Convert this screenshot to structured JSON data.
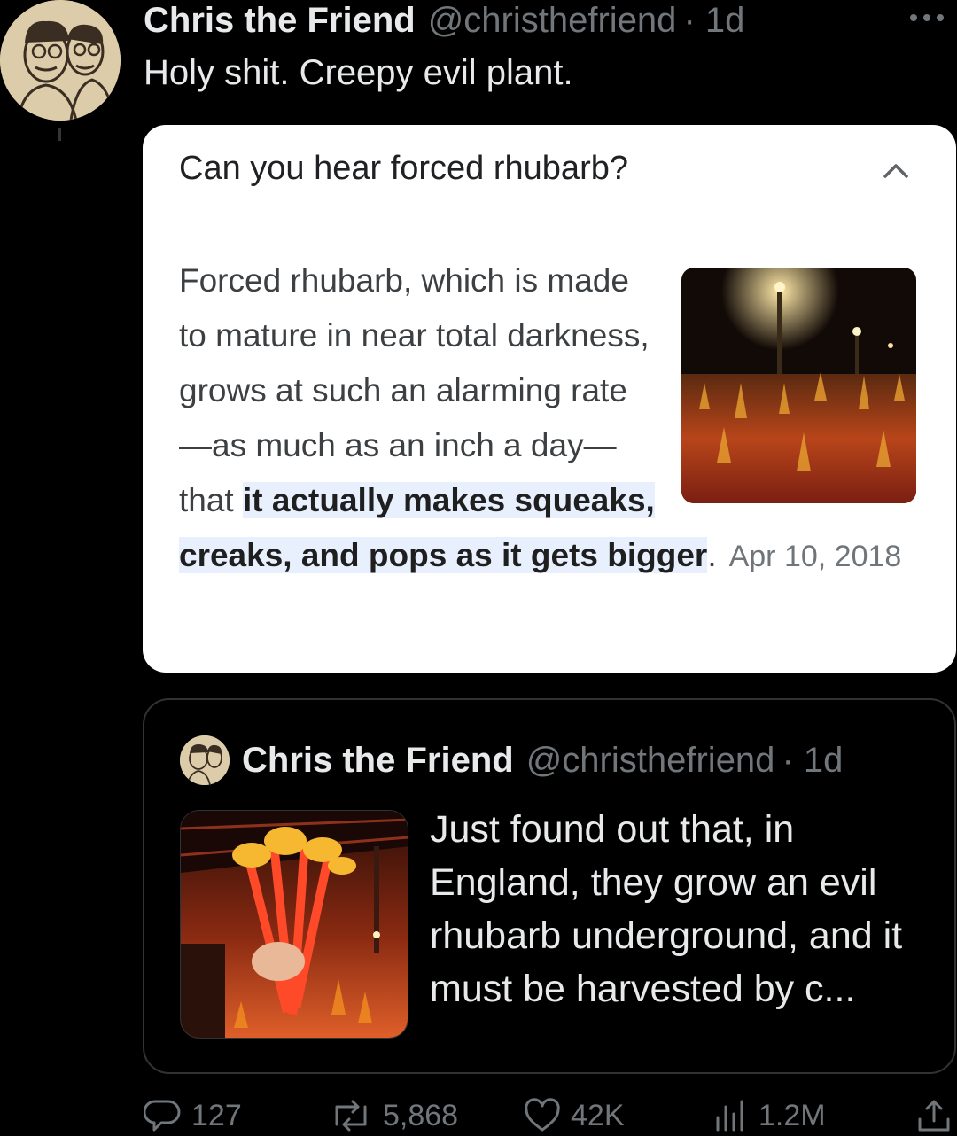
{
  "tweet": {
    "author_name": "Chris the Friend",
    "author_handle": "@christhefriend",
    "time": "· 1d",
    "text": "Holy shit. Creepy evil plant."
  },
  "card": {
    "question": "Can you hear forced rhubarb?",
    "body_plain": "Forced rhubarb, which is made to mature in near total darkness, grows at such an alarming rate—as much as an inch a day—that ",
    "body_highlight": "it actually makes squeaks, creaks, and pops as it gets bigger",
    "body_end": ".",
    "date": "Apr 10, 2018"
  },
  "quote": {
    "author_name": "Chris the Friend",
    "author_handle": "@christhefriend",
    "time": "· 1d",
    "text": "Just found out that, in England, they grow an evil rhubarb underground, and it must be harvested by c..."
  },
  "actions": {
    "replies": "127",
    "reposts": "5,868",
    "likes": "42K",
    "views": "1.2M"
  },
  "colors": {
    "background": "#000000",
    "text": "#e7e9ea",
    "muted": "#71767b",
    "card_bg": "#ffffff",
    "highlight": "#e8f0fe"
  },
  "icons": [
    "more-icon",
    "chevron-up-icon",
    "reply-icon",
    "repost-icon",
    "like-icon",
    "views-icon",
    "share-icon"
  ]
}
